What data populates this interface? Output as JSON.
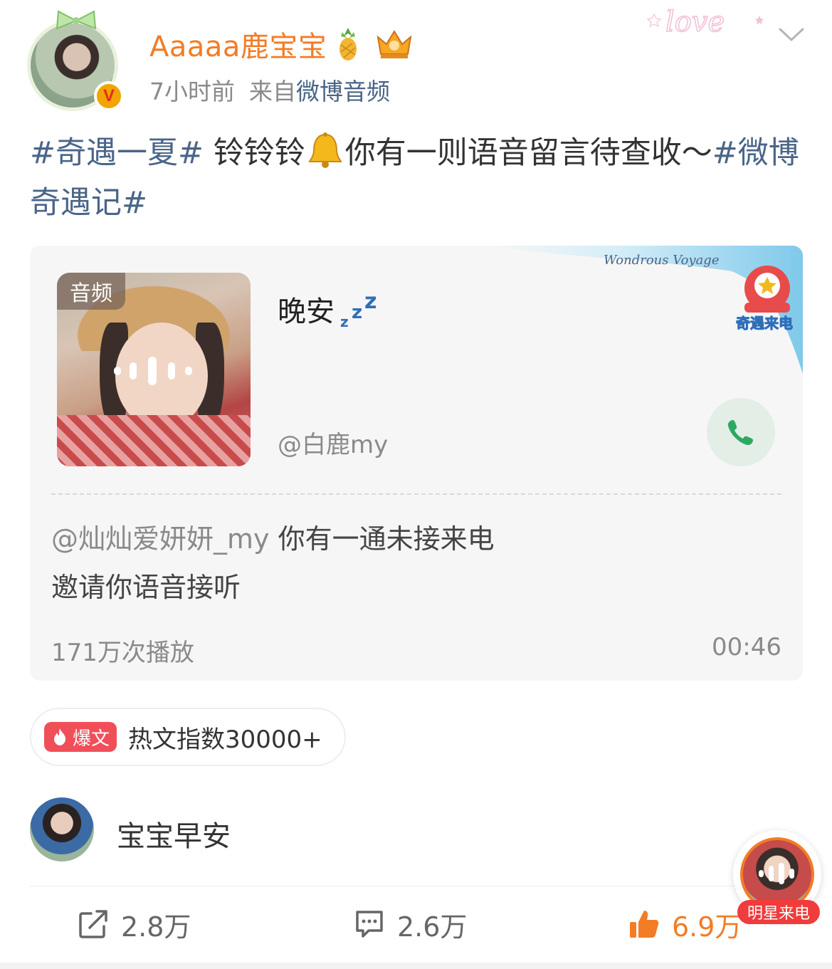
{
  "header": {
    "username": "Aaaaa鹿宝宝",
    "time": "7小时前",
    "source_prefix": "来自",
    "source": "微博音频",
    "verified_mark": "V"
  },
  "post": {
    "topic1": "#奇遇一夏#",
    "text1": " 铃铃铃",
    "text2": "你有一则语音留言待查收～",
    "topic2": "#微博奇遇记#"
  },
  "audio_card": {
    "badge": "音频",
    "title": "晚安",
    "author": "@白鹿my",
    "mention": "@灿灿爱妍妍_my",
    "desc1": " 你有一通未接来电",
    "desc2": "邀请你语音接听",
    "plays": "171万次播放",
    "duration": "00:46"
  },
  "hot": {
    "tag": "爆文",
    "text": "热文指数30000+"
  },
  "comment": {
    "text": "宝宝早安"
  },
  "actions": {
    "share_count": "2.8万",
    "comment_count": "2.6万",
    "like_count": "6.9万"
  },
  "float_call": {
    "label": "明星来电"
  },
  "colors": {
    "username": "#f37c26",
    "topic": "#4a6588",
    "like": "#f37c26",
    "hot_tag": "#f04f5a",
    "call_btn": "#2ea860"
  }
}
